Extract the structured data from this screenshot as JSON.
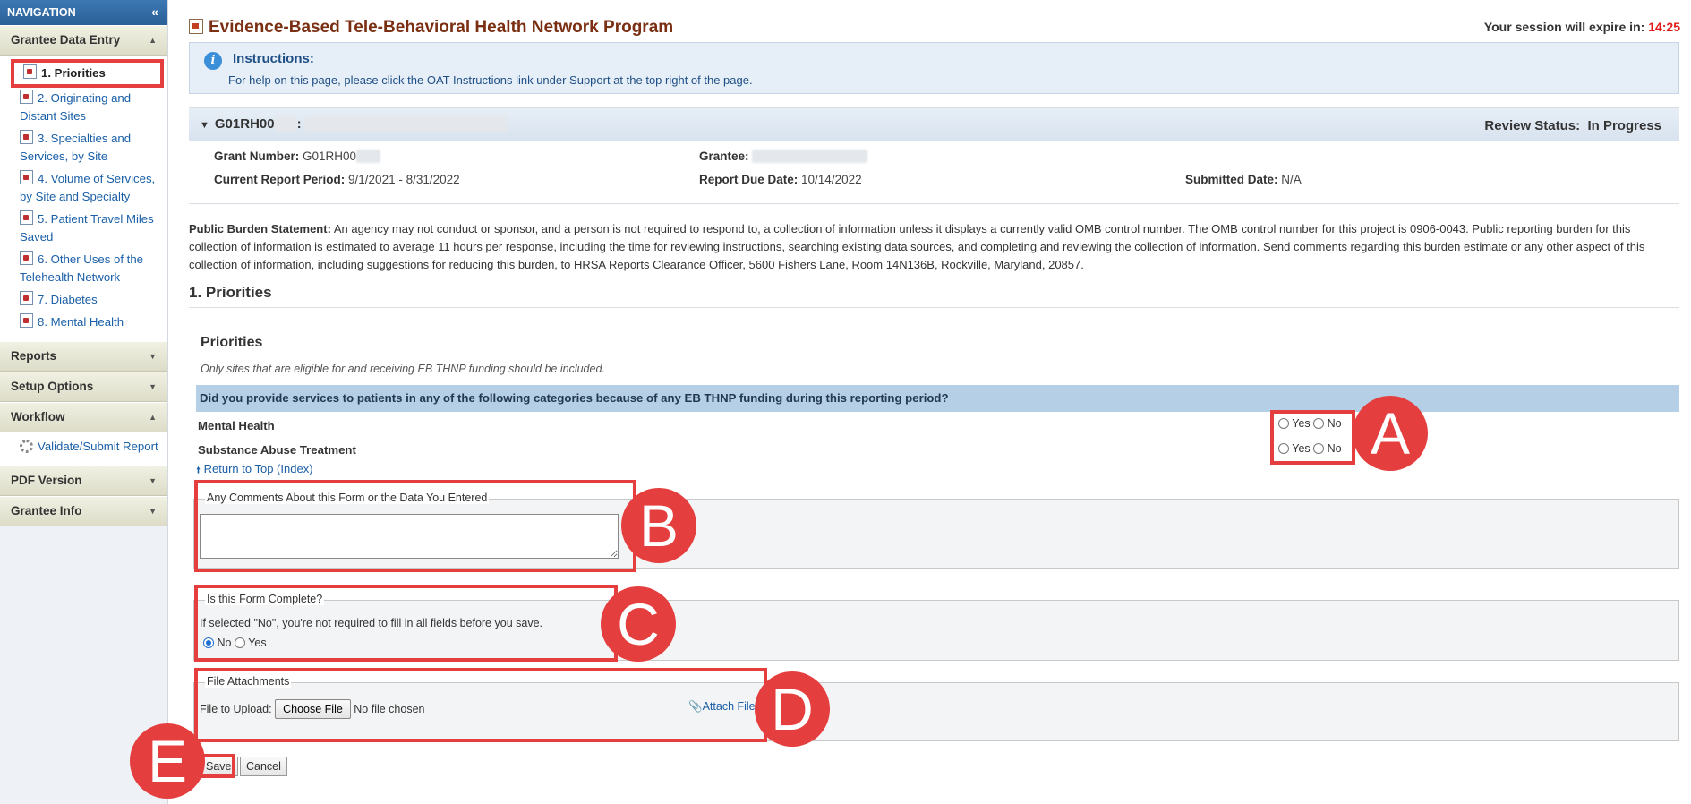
{
  "sidebar": {
    "title": "NAVIGATION",
    "collapse_glyph": "«",
    "grantee_data_entry": {
      "label": "Grantee Data Entry",
      "items": [
        {
          "label": "1. Priorities"
        },
        {
          "label": "2. Originating and Distant Sites"
        },
        {
          "label": "3. Specialties and Services, by Site"
        },
        {
          "label": "4. Volume of Services, by Site and Specialty"
        },
        {
          "label": "5. Patient Travel Miles Saved"
        },
        {
          "label": "6. Other Uses of the Telehealth Network"
        },
        {
          "label": "7. Diabetes"
        },
        {
          "label": "8. Mental Health"
        }
      ]
    },
    "reports": "Reports",
    "setup_options": "Setup Options",
    "workflow": {
      "label": "Workflow",
      "item": "Validate/Submit Report"
    },
    "pdf_version": "PDF Version",
    "grantee_info": "Grantee Info"
  },
  "header": {
    "title": "Evidence-Based Tele-Behavioral Health Network Program",
    "session_label": "Your session will expire in:",
    "session_time": "14:25"
  },
  "instructions": {
    "title": "Instructions:",
    "text": "For help on this page, please click the OAT Instructions link under Support at the top right of the page."
  },
  "grant": {
    "id_prefix": "G01RH00",
    "review_label": "Review Status:",
    "review_value": "In Progress",
    "grant_number_label": "Grant Number:",
    "grant_number_value": "G01RH00",
    "grantee_label": "Grantee:",
    "current_period_label": "Current Report Period:",
    "current_period_value": "9/1/2021 - 8/31/2022",
    "due_date_label": "Report Due Date:",
    "due_date_value": "10/14/2022",
    "submitted_label": "Submitted Date:",
    "submitted_value": "N/A"
  },
  "burden": {
    "label": "Public Burden Statement:",
    "text": "An agency may not conduct or sponsor, and a person is not required to respond to, a collection of information unless it displays a currently valid OMB control number. The OMB control number for this project is 0906-0043. Public reporting burden for this collection of information is estimated to average 11 hours per response, including the time for reviewing instructions, searching existing data sources, and completing and reviewing the collection of information. Send comments regarding this burden estimate or any other aspect of this collection of information, including suggestions for reducing this burden, to HRSA Reports Clearance Officer, 5600 Fishers Lane, Room 14N136B, Rockville, Maryland, 20857."
  },
  "section_title": "1. Priorities",
  "priorities": {
    "title": "Priorities",
    "note": "Only sites that are eligible for and receiving EB THNP funding should be included.",
    "question": "Did you provide services to patients in any of the following categories because of any EB THNP funding during this reporting period?",
    "rows": [
      {
        "label": "Mental Health",
        "yes": "Yes",
        "no": "No"
      },
      {
        "label": "Substance Abuse Treatment",
        "yes": "Yes",
        "no": "No"
      }
    ],
    "return_top": "Return to Top (Index)"
  },
  "comments": {
    "legend": "Any Comments About this Form or the Data You Entered",
    "value": ""
  },
  "complete": {
    "legend": "Is this Form Complete?",
    "note": "If selected \"No\", you're not required to fill in all fields before you save.",
    "no_label": "No",
    "yes_label": "Yes",
    "selected": "No"
  },
  "attachments": {
    "legend": "File Attachments",
    "upload_label": "File to Upload:",
    "choose_button": "Choose File",
    "file_status": "No file chosen",
    "attach_link": "Attach File"
  },
  "actions": {
    "save": "Save",
    "cancel": "Cancel"
  },
  "callouts": {
    "a": "A",
    "b": "B",
    "c": "C",
    "d": "D",
    "e": "E"
  },
  "colors": {
    "callout_red": "#e53e3e",
    "title_brown": "#7a2e12",
    "session_red": "#e11b1b",
    "question_bar": "#b5cfe6",
    "link_blue": "#1a5fa8"
  }
}
